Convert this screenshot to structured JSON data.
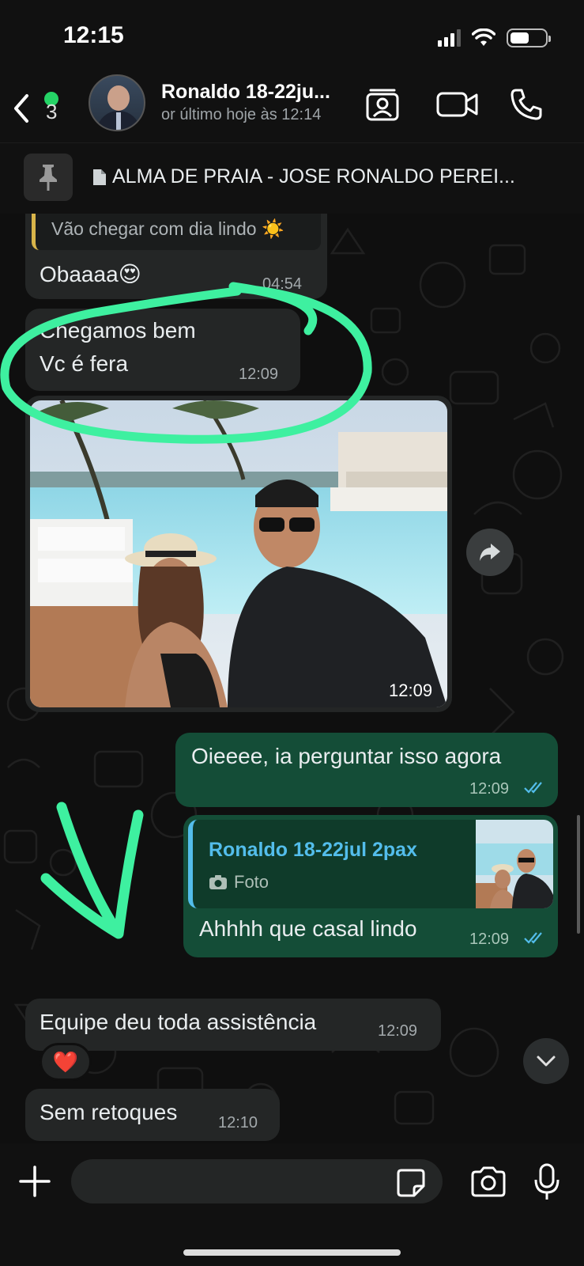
{
  "status_bar": {
    "time": "12:15"
  },
  "header": {
    "back_count": "3",
    "contact_name": "Ronaldo 18-22ju...",
    "contact_status": "or último hoje às 12:14"
  },
  "pinned": {
    "text": "ALMA DE PRAIA - JOSE RONALDO PEREI..."
  },
  "messages": {
    "m1": {
      "quote_text": "Vão chegar com dia lindo ☀️",
      "text": "Obaaaa😍",
      "time": "04:54"
    },
    "m2": {
      "line1": "Chegamos bem",
      "line2": "Vc é fera",
      "time": "12:09"
    },
    "m3": {
      "time": "12:09"
    },
    "m4": {
      "text": "Oieeee, ia perguntar isso agora",
      "time": "12:09"
    },
    "m5": {
      "reply_author": "Ronaldo 18-22jul 2pax",
      "reply_type": "Foto",
      "text": "Ahhhh que casal lindo",
      "time": "12:09"
    },
    "m6": {
      "text": "Equipe deu toda assistência",
      "time": "12:09",
      "reaction": "❤️"
    },
    "m7": {
      "text": "Sem retoques",
      "time": "12:10"
    }
  },
  "colors": {
    "incoming_bubble": "#242626",
    "outgoing_bubble": "#144d37",
    "accent_green": "#25d366",
    "read_ticks": "#53bdeb",
    "annotation": "#3ef0a0"
  },
  "icons": [
    "back-chevron-icon",
    "contact-card-icon",
    "video-call-icon",
    "phone-icon",
    "pin-icon",
    "document-icon",
    "forward-icon",
    "scroll-down-icon",
    "plus-icon",
    "sticker-icon",
    "camera-icon",
    "microphone-icon"
  ]
}
